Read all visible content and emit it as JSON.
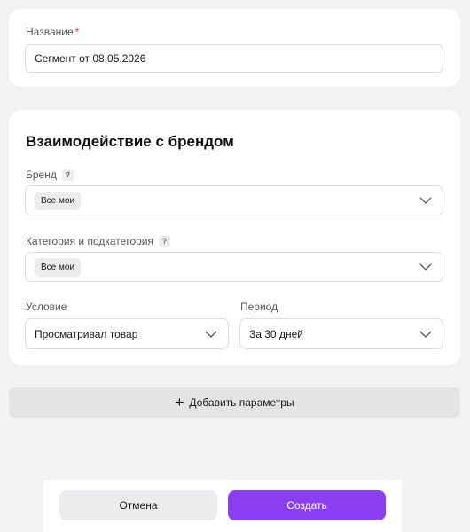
{
  "name_field": {
    "label": "Название",
    "required_mark": "*",
    "value": "Сегмент от 08.05.2026"
  },
  "brand_section": {
    "title": "Взаимодействие с брендом",
    "brand": {
      "label": "Бренд",
      "help": "?",
      "chip": "Все мои"
    },
    "category": {
      "label": "Категория и подкатегория",
      "help": "?",
      "chip": "Все мои"
    },
    "condition": {
      "label": "Условие",
      "value": "Просматривал товар"
    },
    "period": {
      "label": "Период",
      "value": "За 30 дней"
    }
  },
  "add_params": {
    "icon": "+",
    "label": "Добавить параметры"
  },
  "footer": {
    "cancel_label": "Отмена",
    "create_label": "Создать"
  },
  "colors": {
    "accent": "#8b3ff2",
    "required": "#e5352b",
    "background": "#f2f2f4"
  }
}
